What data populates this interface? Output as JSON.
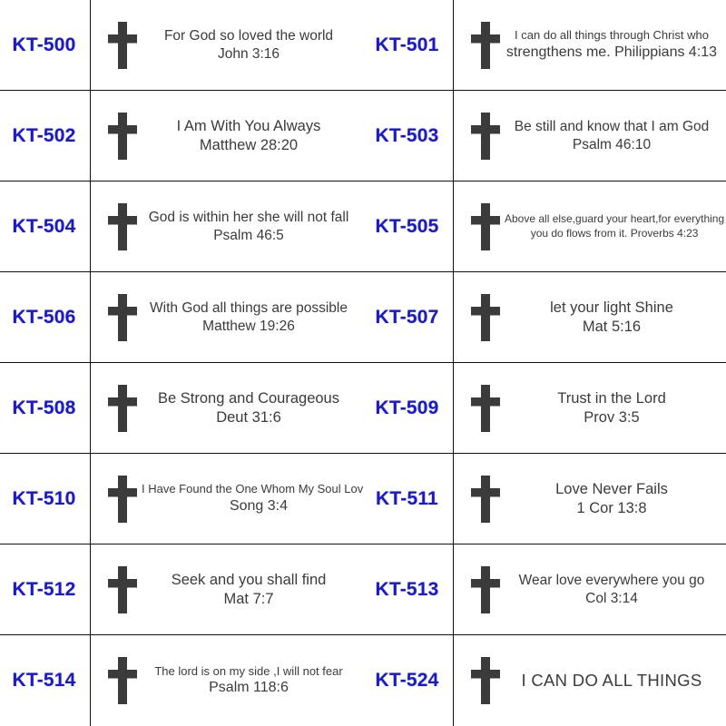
{
  "sheet": {
    "icon": "cross-icon",
    "code_color": "#1a1ac8",
    "text_color": "#3b3b3b",
    "grid_line_color": "#111111",
    "background": "#ffffff",
    "columns": 2,
    "rows": 8
  },
  "items": [
    {
      "code": "KT-500",
      "line1": "For God so loved the world",
      "line2": "John 3:16",
      "size": "t-md"
    },
    {
      "code": "KT-501",
      "line1": "I can do all things through Christ who",
      "line2": "strengthens me.  Philippians 4:13",
      "size": "t-sm"
    },
    {
      "code": "KT-502",
      "line1": "I Am With You Always",
      "line2": "Matthew 28:20",
      "size": "t-lg"
    },
    {
      "code": "KT-503",
      "line1": "Be still and know that I am God",
      "line2": "Psalm 46:10",
      "size": "t-md"
    },
    {
      "code": "KT-504",
      "line1": "God is within her she will not fall",
      "line2": "Psalm 46:5",
      "size": "t-md"
    },
    {
      "code": "KT-505",
      "line1": "Above all else,guard your heart,for everything",
      "line2": "you do flows from it.  Proverbs 4:23",
      "size": "t-xs"
    },
    {
      "code": "KT-506",
      "line1": "With God all things are possible",
      "line2": "Matthew 19:26",
      "size": "t-md"
    },
    {
      "code": "KT-507",
      "line1": "let your light Shine",
      "line2": "Mat 5:16",
      "size": "t-lg"
    },
    {
      "code": "KT-508",
      "line1": "Be Strong and Courageous",
      "line2": "Deut 31:6",
      "size": "t-lg"
    },
    {
      "code": "KT-509",
      "line1": "Trust in the Lord",
      "line2": "Prov 3:5",
      "size": "t-lg"
    },
    {
      "code": "KT-510",
      "line1": "I Have Found the One Whom My Soul Loves",
      "line2": "Song 3:4",
      "size": "t-sm"
    },
    {
      "code": "KT-511",
      "line1": "Love Never Fails",
      "line2": "1 Cor 13:8",
      "size": "t-lg"
    },
    {
      "code": "KT-512",
      "line1": "Seek and you shall find",
      "line2": "Mat 7:7",
      "size": "t-lg"
    },
    {
      "code": "KT-513",
      "line1": "Wear love everywhere you go",
      "line2": "Col 3:14",
      "size": "t-md"
    },
    {
      "code": "KT-514",
      "line1": "The lord is on my side ,I will not fear",
      "line2": "Psalm 118:6",
      "size": "t-sm"
    },
    {
      "code": "KT-524",
      "line1": "I CAN DO ALL THINGS",
      "line2": "",
      "size": "single"
    }
  ]
}
